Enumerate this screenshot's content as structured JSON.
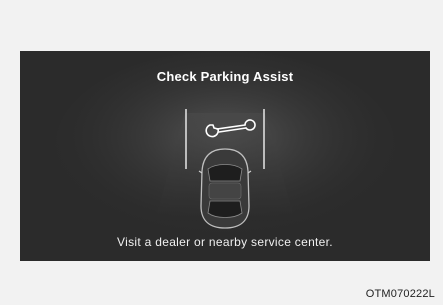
{
  "warning": {
    "title": "Check Parking Assist",
    "message": "Visit a dealer or nearby service center."
  },
  "icons": {
    "service": "wrench-icon",
    "vehicle": "car-top-view-icon"
  },
  "colors": {
    "panel_bg": "#2b2b2b",
    "text": "#ffffff",
    "page_bg": "#f2f2f2"
  },
  "caption": "OTM070222L"
}
